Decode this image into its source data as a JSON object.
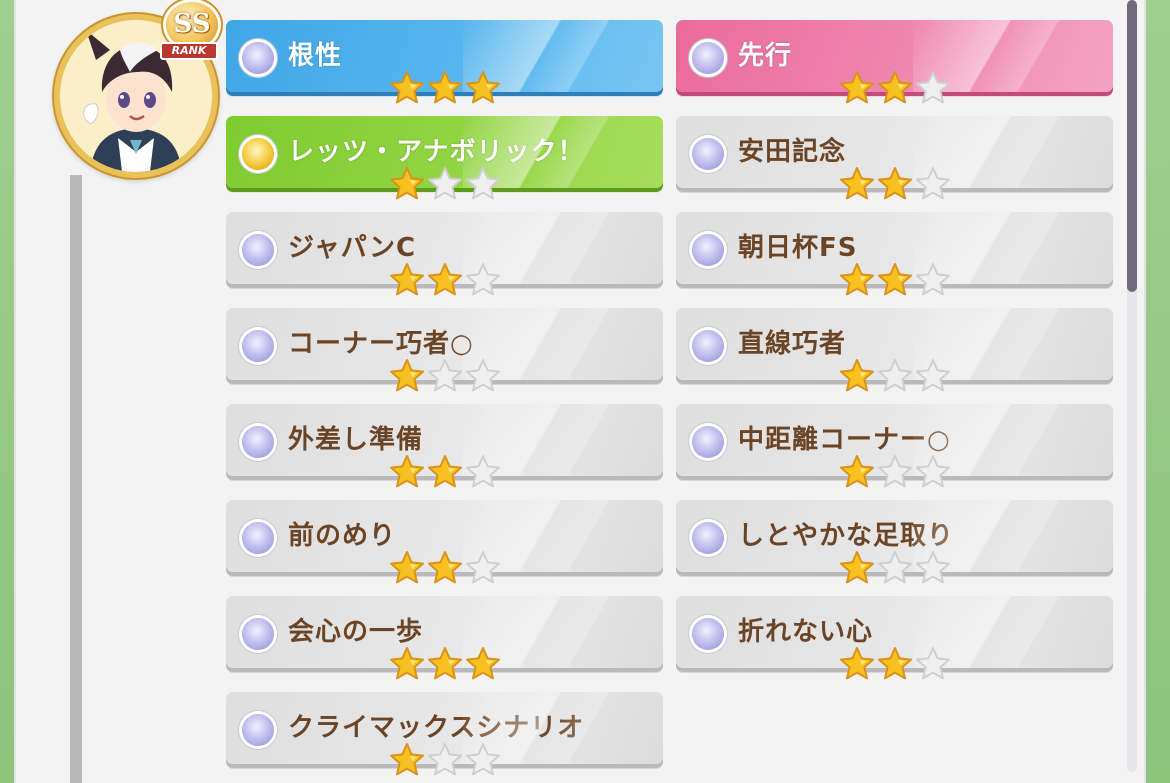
{
  "character": {
    "rank_main": "SS",
    "rank_label": "RANK"
  },
  "skills": [
    {
      "name": "根性",
      "stars": 3,
      "style": "blue",
      "orb": "silver"
    },
    {
      "name": "先行",
      "stars": 2,
      "style": "pink",
      "orb": "silver"
    },
    {
      "name": "レッツ・アナボリック！",
      "stars": 1,
      "style": "green",
      "orb": "gold"
    },
    {
      "name": "安田記念",
      "stars": 2,
      "style": "gray",
      "orb": "silver"
    },
    {
      "name": "ジャパンC",
      "stars": 2,
      "style": "gray",
      "orb": "silver"
    },
    {
      "name": "朝日杯FS",
      "stars": 2,
      "style": "gray",
      "orb": "silver"
    },
    {
      "name": "コーナー巧者○",
      "stars": 1,
      "style": "gray",
      "orb": "silver"
    },
    {
      "name": "直線巧者",
      "stars": 1,
      "style": "gray",
      "orb": "silver"
    },
    {
      "name": "外差し準備",
      "stars": 2,
      "style": "gray",
      "orb": "silver"
    },
    {
      "name": "中距離コーナー○",
      "stars": 1,
      "style": "gray",
      "orb": "silver"
    },
    {
      "name": "前のめり",
      "stars": 2,
      "style": "gray",
      "orb": "silver"
    },
    {
      "name": "しとやかな足取り",
      "stars": 1,
      "style": "gray",
      "orb": "silver"
    },
    {
      "name": "会心の一歩",
      "stars": 3,
      "style": "gray",
      "orb": "silver"
    },
    {
      "name": "折れない心",
      "stars": 2,
      "style": "gray",
      "orb": "silver"
    },
    {
      "name": "クライマックスシナリオ",
      "stars": 1,
      "style": "gray",
      "orb": "silver"
    }
  ],
  "colors": {
    "star_filled": "#f7c21f",
    "star_empty": "#efefef",
    "text_brown": "#6b4425"
  }
}
